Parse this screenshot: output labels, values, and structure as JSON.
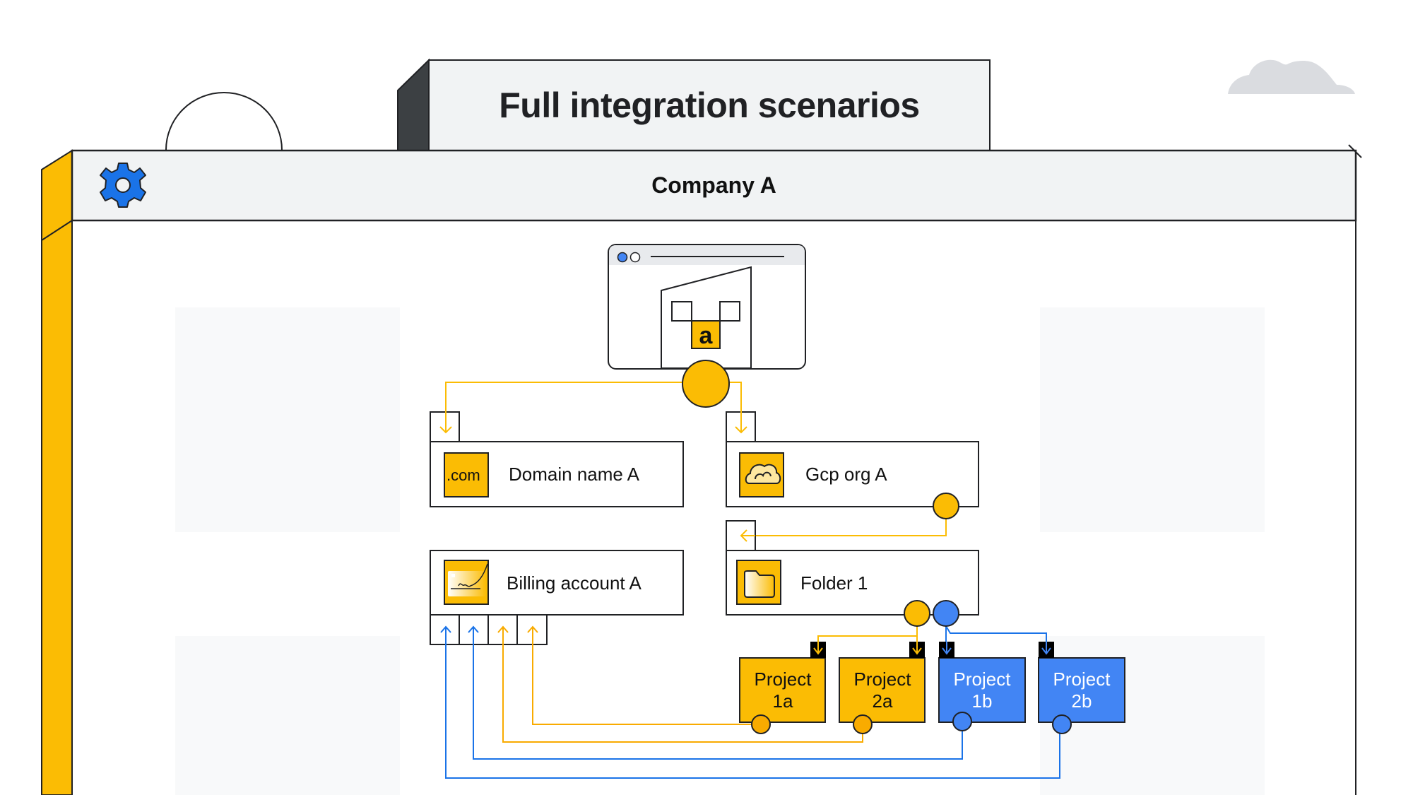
{
  "title": "Full integration scenarios",
  "company": {
    "name": "Company A"
  },
  "colors": {
    "yellow": "#FBBC04",
    "blue": "#4285F4",
    "dark_blue": "#1A73E8",
    "panel_gray": "#F1F3F4",
    "dark_side": "#3C4043",
    "outline": "#202124"
  },
  "logo": {
    "letter": "a"
  },
  "nodes": {
    "domain": {
      "label": "Domain name A",
      "icon_text": ".com",
      "icon": "domain-icon"
    },
    "gcp_org": {
      "label": "Gcp org A",
      "icon": "cloud-icon"
    },
    "billing": {
      "label": "Billing account A",
      "icon": "billing-card-icon"
    },
    "folder": {
      "label": "Folder 1",
      "icon": "folder-icon"
    }
  },
  "projects": [
    {
      "line1": "Project",
      "line2": "1a",
      "color": "yellow"
    },
    {
      "line1": "Project",
      "line2": "2a",
      "color": "yellow"
    },
    {
      "line1": "Project",
      "line2": "1b",
      "color": "blue"
    },
    {
      "line1": "Project",
      "line2": "2b",
      "color": "blue"
    }
  ]
}
